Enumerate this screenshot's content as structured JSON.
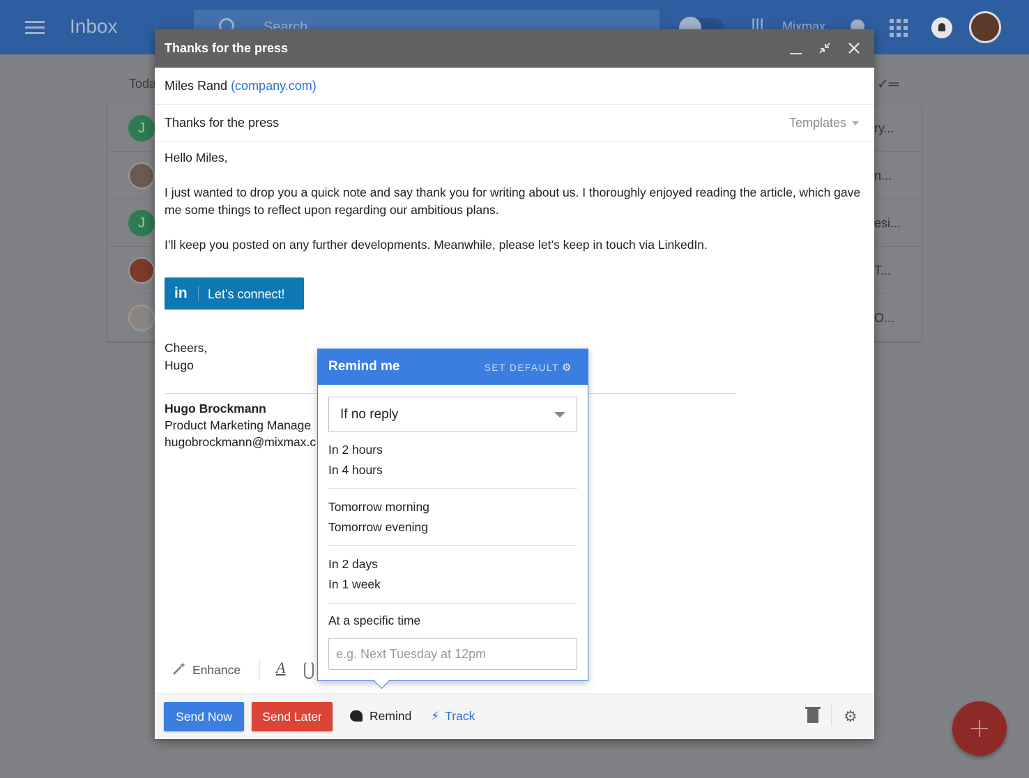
{
  "app": {
    "title": "Inbox",
    "search_placeholder": "Search",
    "mixmax_label": "Mixmax",
    "today_label": "Today"
  },
  "inbox_rows": [
    {
      "avatar_letter": "J",
      "snippet": "ry..."
    },
    {
      "avatar_letter": "",
      "snippet": "n..."
    },
    {
      "avatar_letter": "J",
      "snippet": "esi..."
    },
    {
      "avatar_letter": "",
      "snippet": "T..."
    },
    {
      "avatar_letter": "",
      "snippet": "O..."
    }
  ],
  "compose": {
    "title": "Thanks for the press",
    "recipient_name": "Miles Rand",
    "recipient_domain": "(company.com)",
    "subject": "Thanks for the press",
    "templates_label": "Templates",
    "body": {
      "greeting": "Hello Miles,",
      "para1": "I just wanted to drop you a quick note and say thank you for writing about us. I thoroughly enjoyed reading the article, which gave me some things to reflect upon regarding our ambitious plans.",
      "para2": "I’ll keep you posted on any further developments. Meanwhile, please let’s keep in touch via LinkedIn.",
      "linkedin_icon": "in",
      "linkedin_label": "Let's connect!",
      "closing": "Cheers,",
      "sender_first": "Hugo"
    },
    "signature": {
      "name": "Hugo Brockmann",
      "title": "Product Marketing Manage",
      "email": "hugobrockmann@mixmax.c"
    },
    "toolbar": {
      "enhance_label": "Enhance",
      "text_format_glyph": "A"
    },
    "footer": {
      "send_now": "Send Now",
      "send_later": "Send Later",
      "remind": "Remind",
      "track": "Track"
    }
  },
  "remind_popup": {
    "title": "Remind me",
    "set_default": "SET DEFAULT",
    "condition": "If no reply",
    "options": [
      "In 2 hours",
      "In 4 hours",
      "Tomorrow morning",
      "Tomorrow evening",
      "In 2 days",
      "In 1 week",
      "At a specific time"
    ],
    "time_placeholder": "e.g. Next Tuesday at 12pm"
  },
  "colors": {
    "primary_blue": "#3b7ee2",
    "send_later_red": "#db4436",
    "linkedin_blue": "#0e78b4",
    "header_gray": "#616161",
    "link_blue": "#2a6fd6"
  }
}
